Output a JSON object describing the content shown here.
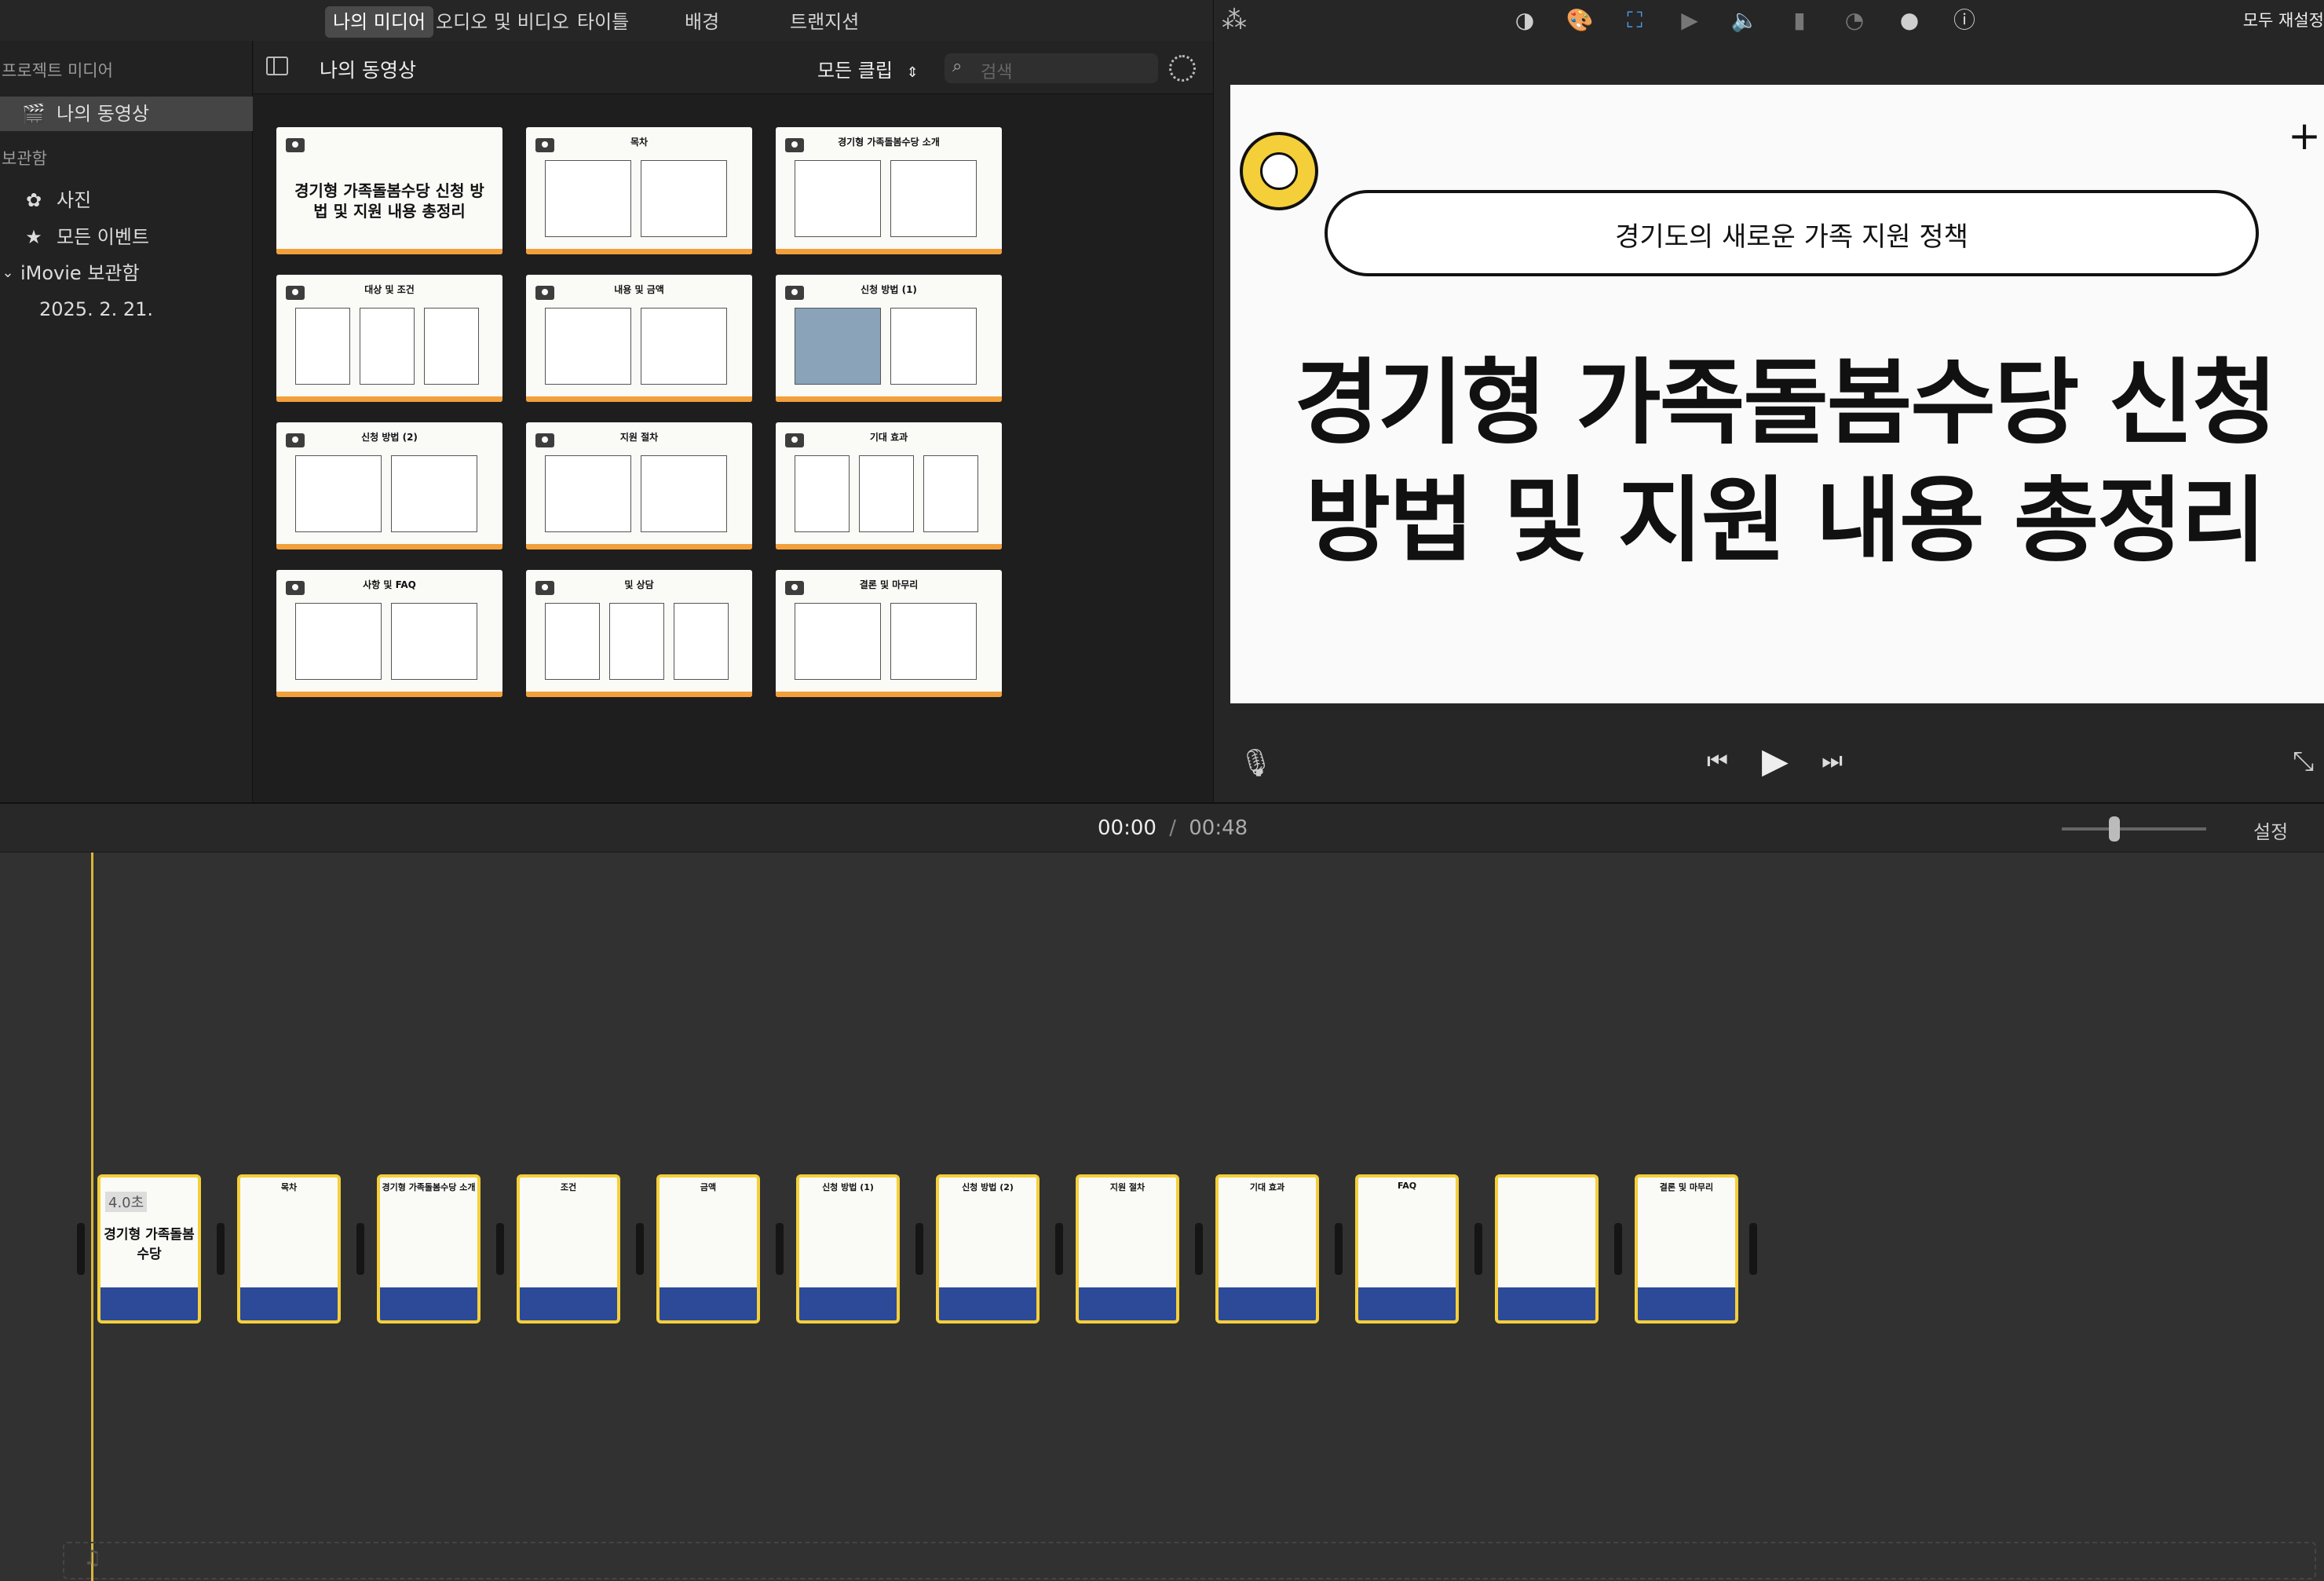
{
  "tabs": [
    "나의 미디어",
    "오디오 및 비디오",
    "타이틀",
    "배경",
    "트랜지션"
  ],
  "sidebar": {
    "project_media_header": "프로젝트 미디어",
    "my_movie": "나의 동영상",
    "library_header": "보관함",
    "photos": "사진",
    "all_events": "모든 이벤트",
    "imovie_library": "iMovie 보관함",
    "event_date": "2025. 2. 21."
  },
  "browser": {
    "title": "나의 동영상",
    "filter": "모든 클립",
    "search_placeholder": "검색",
    "thumbnails": [
      {
        "title": "경기형 가족돌봄수당 신청 방법 및 지원 내용 총정리",
        "kind": "cover"
      },
      {
        "title": "목차",
        "kind": "toc"
      },
      {
        "title": "경기형 가족돌봄수당 소개",
        "kind": "intro"
      },
      {
        "title": "대상 및 조건",
        "kind": "cols"
      },
      {
        "title": "내용 및 금액",
        "kind": "grid"
      },
      {
        "title": "신청 방법 (1)",
        "kind": "photo"
      },
      {
        "title": "신청 방법 (2)",
        "kind": "flow"
      },
      {
        "title": "지원 절차",
        "kind": "steps"
      },
      {
        "title": "기대 효과",
        "kind": "photos"
      },
      {
        "title": "사항 및 FAQ",
        "kind": "faq"
      },
      {
        "title": "및 상담",
        "kind": "cols"
      },
      {
        "title": "결론 및 마무리",
        "kind": "end"
      }
    ]
  },
  "viewer": {
    "reset_all": "모두 재설정",
    "slide_subtitle": "경기도의 새로운 가족 지원 정책",
    "slide_title_line1": "경기형 가족돌봄수당 신청",
    "slide_title_line2": "방법 및 지원 내용 총정리"
  },
  "timeline": {
    "current_time": "00:00",
    "separator": "/",
    "total_time": "00:48",
    "settings": "설정",
    "first_clip_duration": "4.0초",
    "clips": [
      "경기형 가족돌봄수당",
      "목차",
      "경기형 가족돌봄수당 소개",
      "조건",
      "금액",
      "신청 방법 (1)",
      "신청 방법 (2)",
      "지원 절차",
      "기대 효과",
      "FAQ",
      "",
      "결론 및 마무리"
    ]
  },
  "colors": {
    "accent": "#f4cf3a",
    "clip_band": "#2d4a98",
    "slide_strip": "#f2a03c",
    "selected": "#4a4a4a"
  }
}
